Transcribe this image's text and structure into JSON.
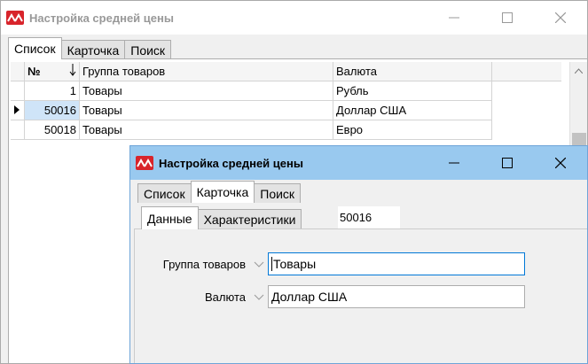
{
  "window_back": {
    "title": "Настройка средней цены",
    "tabs": [
      "Список",
      "Карточка",
      "Поиск"
    ],
    "grid": {
      "headers": {
        "num": "№",
        "group": "Группа товаров",
        "currency": "Валюта"
      },
      "rows": [
        {
          "num": "1",
          "group": "Товары",
          "currency": "Рубль"
        },
        {
          "num": "50016",
          "group": "Товары",
          "currency": "Доллар США"
        },
        {
          "num": "50018",
          "group": "Товары",
          "currency": "Евро"
        }
      ]
    }
  },
  "window_front": {
    "title": "Настройка средней цены",
    "tabs": [
      "Список",
      "Карточка",
      "Поиск"
    ],
    "subtabs": [
      "Данные",
      "Характеристики"
    ],
    "record_id": "50016",
    "fields": {
      "group_label": "Группа товаров",
      "group_value": "Товары",
      "currency_label": "Валюта",
      "currency_value": "Доллар США"
    }
  },
  "colors": {
    "logo": "#d8242b",
    "active_titlebar": "#99c9ef",
    "selection": "#cfe4f8"
  },
  "icons": [
    "app-logo-icon",
    "minimize-icon",
    "maximize-icon",
    "close-icon",
    "sort-arrow-icon",
    "row-pointer-icon",
    "chevron-down-icon",
    "scroll-up-icon"
  ]
}
